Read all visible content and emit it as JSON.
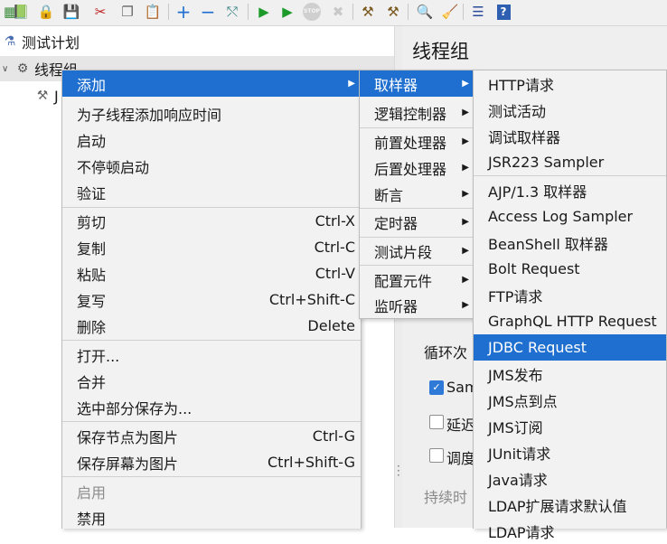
{
  "toolbar": {
    "icons": [
      "template-icon",
      "open-icon",
      "lock-icon",
      "save-icon",
      "cut-icon",
      "copy-icon",
      "paste-icon",
      "expand-icon",
      "collapse-icon",
      "toggle-icon",
      "start-icon",
      "start-no-pause-icon",
      "stop-icon",
      "shutdown-icon",
      "clear-icon",
      "clear-all-icon",
      "search-icon",
      "reset-search-icon",
      "function-helper-icon",
      "help-icon"
    ],
    "stop_label": "STOP"
  },
  "tree": {
    "test_plan": "测试计划",
    "thread_group": "线程组",
    "child_partial": "J"
  },
  "right": {
    "title": "线程组",
    "loop_label_partial": "循环次",
    "same_user_partial": "Sam",
    "delay_partial": "延迟",
    "scheduler_partial": "调度",
    "duration_partial": "持续时"
  },
  "context_menu": {
    "add": "添加",
    "add_think_time": "为子线程添加响应时间",
    "start": "启动",
    "start_no_pause": "不停顿启动",
    "validate": "验证",
    "cut": "剪切",
    "cut_acc": "Ctrl-X",
    "copy": "复制",
    "copy_acc": "Ctrl-C",
    "paste": "粘贴",
    "paste_acc": "Ctrl-V",
    "duplicate": "复写",
    "duplicate_acc": "Ctrl+Shift-C",
    "delete": "删除",
    "delete_acc": "Delete",
    "open": "打开...",
    "merge": "合并",
    "save_selection": "选中部分保存为...",
    "save_node_image": "保存节点为图片",
    "save_node_image_acc": "Ctrl-G",
    "save_screen_image": "保存屏幕为图片",
    "save_screen_image_acc": "Ctrl+Shift-G",
    "enable": "启用",
    "disable": "禁用"
  },
  "add_menu": {
    "sampler": "取样器",
    "logic_controller": "逻辑控制器",
    "pre_processor": "前置处理器",
    "post_processor": "后置处理器",
    "assertion": "断言",
    "timer": "定时器",
    "test_fragment": "测试片段",
    "config_element": "配置元件",
    "listener": "监听器"
  },
  "sampler_menu": [
    "HTTP请求",
    "测试活动",
    "调试取样器",
    "JSR223 Sampler",
    "AJP/1.3 取样器",
    "Access Log Sampler",
    "BeanShell 取样器",
    "Bolt Request",
    "FTP请求",
    "GraphQL HTTP Request",
    "JDBC Request",
    "JMS发布",
    "JMS点到点",
    "JMS订阅",
    "JUnit请求",
    "Java请求",
    "LDAP扩展请求默认值",
    "LDAP请求"
  ],
  "colors": {
    "highlight": "#1f6fd0",
    "menu_bg": "#f2f2f2"
  }
}
